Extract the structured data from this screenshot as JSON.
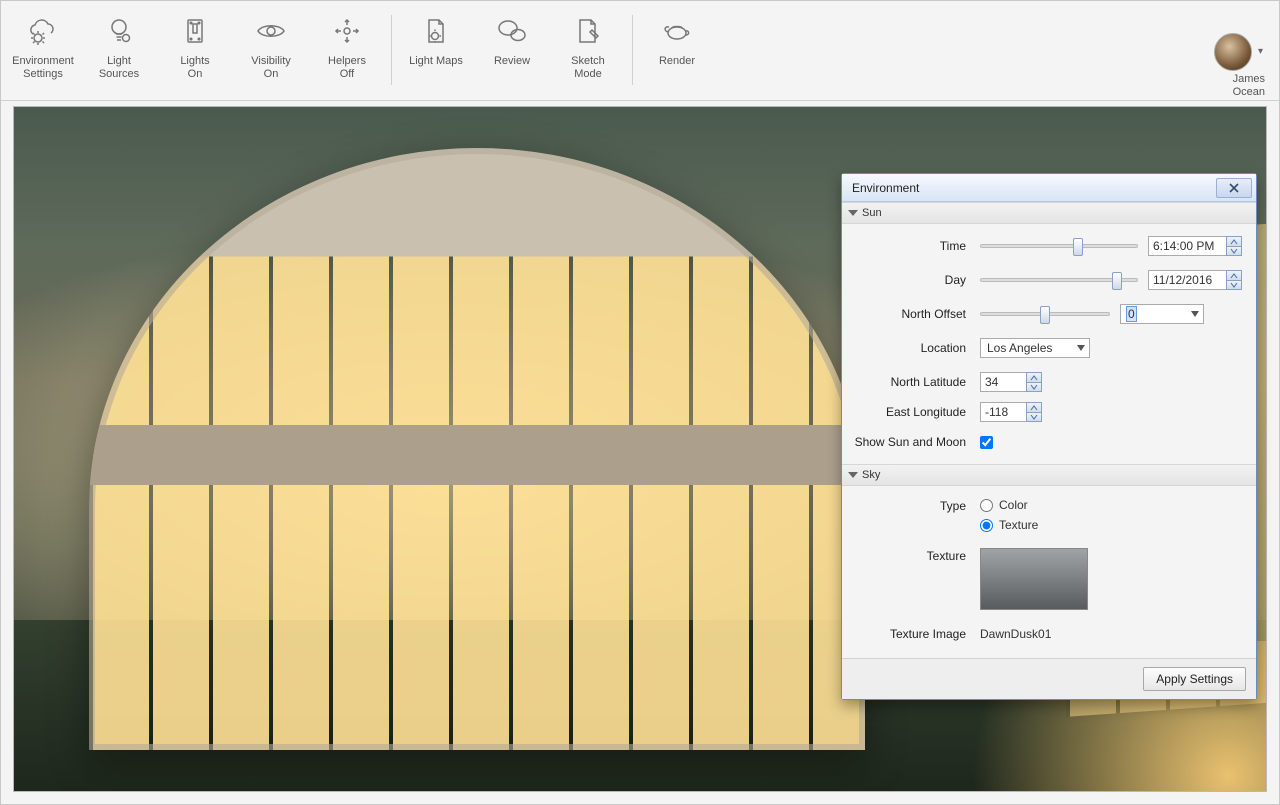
{
  "toolbar": {
    "environment_settings": "Environment\nSettings",
    "light_sources": "Light\nSources",
    "lights_on": "Lights\nOn",
    "visibility_on": "Visibility\nOn",
    "helpers_off": "Helpers\nOff",
    "light_maps": "Light Maps",
    "review": "Review",
    "sketch_mode": "Sketch\nMode",
    "render": "Render"
  },
  "user": {
    "first": "James",
    "last": "Ocean"
  },
  "panel": {
    "title": "Environment",
    "sun_section": "Sun",
    "sky_section": "Sky",
    "labels": {
      "time": "Time",
      "day": "Day",
      "north_offset": "North Offset",
      "location": "Location",
      "north_latitude": "North Latitude",
      "east_longitude": "East Longitude",
      "show_sun_moon": "Show Sun and Moon",
      "type": "Type",
      "texture": "Texture",
      "texture_image": "Texture Image"
    },
    "values": {
      "time": "6:14:00 PM",
      "day": "11/12/2016",
      "north_offset": "0",
      "location": "Los Angeles",
      "north_latitude": "34",
      "east_longitude": "-118",
      "show_sun_moon": true,
      "type_color": "Color",
      "type_texture": "Texture",
      "type_selected": "Texture",
      "texture_image": "DawnDusk01"
    },
    "sliders": {
      "time_pct": 62,
      "day_pct": 87,
      "north_offset_pct": 50
    },
    "apply_button": "Apply Settings"
  }
}
